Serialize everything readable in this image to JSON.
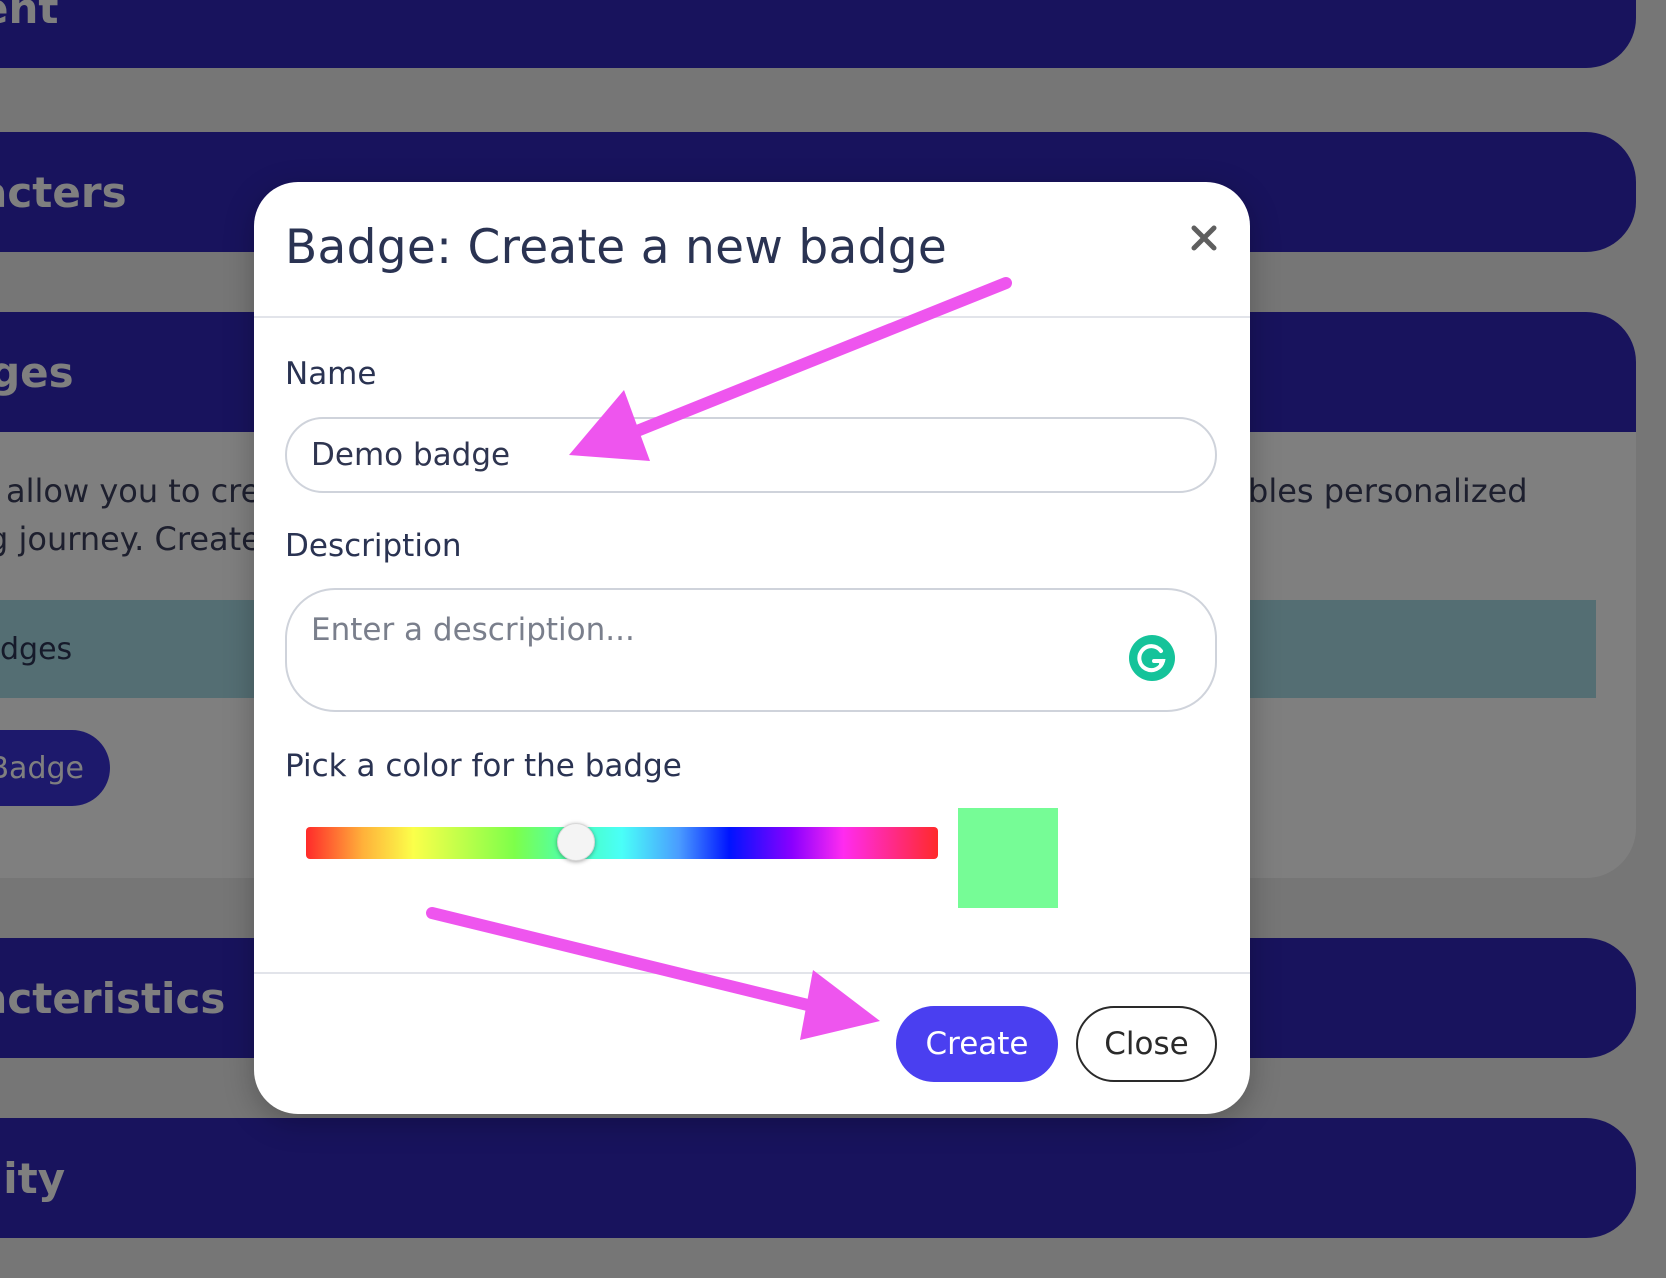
{
  "background": {
    "sections": [
      {
        "label": "ntent"
      },
      {
        "label": "aracters"
      },
      {
        "label": "dges"
      },
      {
        "label": "aracteristics"
      },
      {
        "label": "ibility"
      }
    ],
    "badges_text_line_1_left": "allow you to cre",
    "badges_text_line_1_right": "bles personalized",
    "badges_text_line_2_left": "g journey. Create",
    "table_header_label": "dges",
    "create_badge_button_label": "e Badge"
  },
  "modal": {
    "title": "Badge: Create a new badge",
    "close_icon": "close-icon",
    "name_label": "Name",
    "name_value": "Demo badge",
    "description_label": "Description",
    "description_placeholder": "Enter a description...",
    "description_value": "",
    "grammarly_icon": "grammarly-icon",
    "color_label": "Pick a color for the badge",
    "hue_position": 0.427,
    "selected_color": "#76fc96",
    "create_label": "Create",
    "close_label": "Close"
  },
  "colors": {
    "accent": "#4a3ff0",
    "section_bar": "#3026ba",
    "annotation_arrow": "#ee55ee",
    "grammarly": "#15c39a"
  }
}
